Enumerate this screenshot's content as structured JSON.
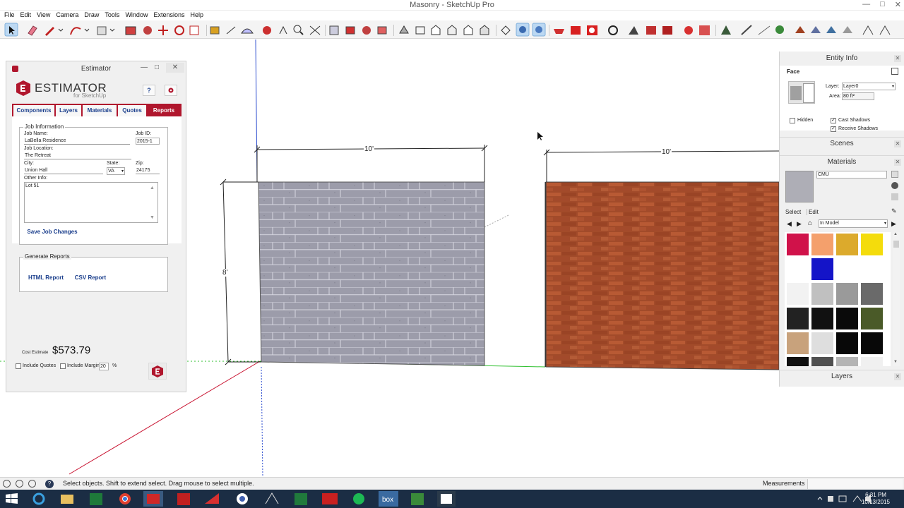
{
  "window": {
    "title": "Masonry - SketchUp Pro",
    "minimize_glyph": "—",
    "maximize_glyph": "□",
    "close_glyph": "✕"
  },
  "menubar": [
    "File",
    "Edit",
    "View",
    "Camera",
    "Draw",
    "Tools",
    "Window",
    "Extensions",
    "Help"
  ],
  "viewport": {
    "dim_top_left": "10'",
    "dim_top_right": "10'",
    "dim_height": "8'",
    "colors": {
      "red_axis": "#c8102e",
      "green_axis": "#30c030",
      "blue_axis": "#3050d0",
      "cmu_fill": "#9e9eaa",
      "brick_fill": "#a8502c"
    }
  },
  "estimator": {
    "title": "Estimator",
    "brand": "ESTIMATOR",
    "subtitle": "for SketchUp",
    "help_label": "?",
    "tabs": [
      "Components",
      "Layers",
      "Materials",
      "Quotes",
      "Reports"
    ],
    "active_tab": "Reports",
    "job_info": {
      "legend": "Job Information",
      "job_name_label": "Job Name:",
      "job_name": "LaBella Residence",
      "job_id_label": "Job ID:",
      "job_id": "2015-1",
      "job_location_label": "Job Location:",
      "job_location": "The Retreat",
      "city_label": "City:",
      "city": "Union Hall",
      "state_label": "State:",
      "state": "VA",
      "zip_label": "Zip:",
      "zip": "24175",
      "other_info_label": "Other Info:",
      "other_info": "Lot 51",
      "save_label": "Save Job Changes"
    },
    "reports": {
      "legend": "Generate Reports",
      "html_label": "HTML Report",
      "csv_label": "CSV Report"
    },
    "cost_label": "Cost Estimate",
    "cost_value": "$573.79",
    "include_quotes_label": "Include Quotes",
    "include_margin_label": "Include Margin",
    "margin_value": "20",
    "percent": "%",
    "accent": "#b0162d"
  },
  "entity_info": {
    "title": "Entity Info",
    "type": "Face",
    "layer_label": "Layer:",
    "layer_value": "Layer0",
    "area_label": "Area:",
    "area_value": "80 ft²",
    "hidden_label": "Hidden",
    "cast_shadows_label": "Cast Shadows",
    "receive_shadows_label": "Receive Shadows"
  },
  "scenes": {
    "title": "Scenes"
  },
  "materials": {
    "title": "Materials",
    "name": "CMU",
    "select_tab": "Select",
    "edit_tab": "Edit",
    "collection": "In Model",
    "swatches": [
      "#d0124a",
      "#f4a06c",
      "#dcaa2c",
      "#f4dc0c",
      "#ffffff",
      "#1414c8",
      "#ffffff",
      "#ffffff",
      "#f2f2f2",
      "#c0c0c0",
      "#9a9a9a",
      "#6a6a6a",
      "#222222",
      "#111111",
      "#0a0a0a",
      "#4a5a28",
      "#c8a27c",
      "#dedede",
      "#080808",
      "#080808",
      "#101010",
      "#505050",
      "#b4b4b4",
      "#f0f0f0"
    ]
  },
  "layers_panel": {
    "title": "Layers"
  },
  "status": {
    "text": "Select objects. Shift to extend select. Drag mouse to select multiple.",
    "measurements_label": "Measurements"
  },
  "taskbar": {
    "time": "6:31 PM",
    "date": "10/13/2015",
    "apps": [
      "start",
      "internet-explorer",
      "file-explorer",
      "excel-sheets",
      "chrome",
      "sketchup",
      "acrobat",
      "layout",
      "cortana",
      "inkscape",
      "excel",
      "camtasia",
      "spotify",
      "box",
      "camtasia-recorder",
      "terminal"
    ]
  }
}
